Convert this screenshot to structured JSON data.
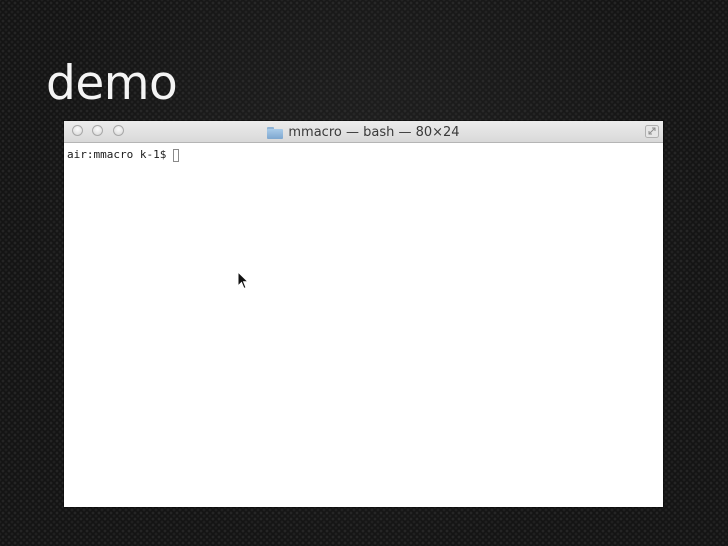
{
  "slide": {
    "title": "demo"
  },
  "terminal": {
    "title": "mmacro — bash — 80×24",
    "prompt": "air:mmacro k-1$",
    "icons": {
      "title_icon": "folder-icon",
      "resize": "resize-icon",
      "pointer": "mouse-pointer-icon"
    },
    "traffic_lights": [
      "close",
      "minimize",
      "zoom"
    ]
  },
  "colors": {
    "background": "#141414",
    "title_text": "#f4f4f4",
    "terminal_background": "#ffffff",
    "titlebar": "#e0e0e0"
  }
}
